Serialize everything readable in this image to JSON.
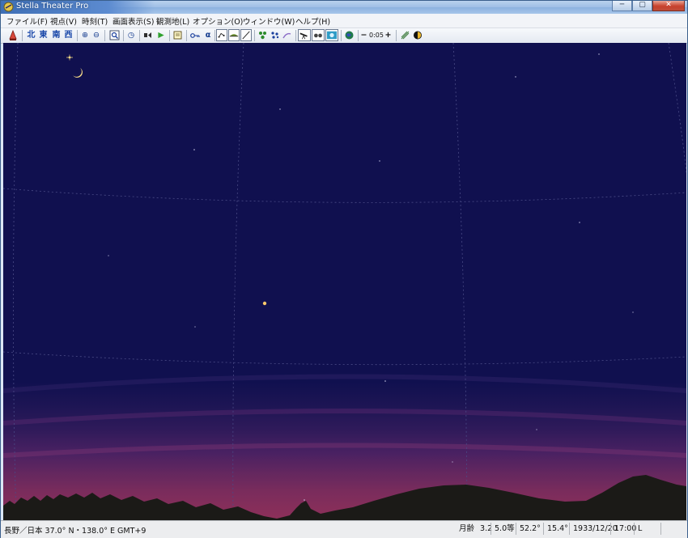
{
  "window": {
    "title": "Stella Theater Pro",
    "caption_minimize": "─",
    "caption_maximize": "▢",
    "caption_close": "✕"
  },
  "menu": [
    {
      "label": "ファイル(F)"
    },
    {
      "label": "視点(V)"
    },
    {
      "label": "時刻(T)"
    },
    {
      "label": "画面表示(S)"
    },
    {
      "label": "観測地(L)"
    },
    {
      "label": "オプション(O)"
    },
    {
      "label": "ウィンドウ(W)"
    },
    {
      "label": "ヘルプ(H)"
    }
  ],
  "toolbar": {
    "directions": [
      "北",
      "東",
      "南",
      "西"
    ],
    "zoom_in": "⊕",
    "zoom_out": "⊖",
    "clock": "◷",
    "play": "▶",
    "alpha": "α",
    "step_minus": "−",
    "step_value": "0:05",
    "step_plus": "+"
  },
  "status": {
    "location": "長野／日本  37.0° N・138.0° E  GMT+9",
    "moon_age_label": "月齢",
    "moon_age": "3.2",
    "magnitude": "5.0等",
    "field1": "52.2°",
    "field2": "15.4°",
    "date": "1933/12/20",
    "time": "17:00",
    "mode": "L"
  },
  "colors": {
    "sky_top": "#10104f",
    "horizon_glow": "#8e3059",
    "mountain": "#1b1a17",
    "grid": "#4a4b86"
  }
}
